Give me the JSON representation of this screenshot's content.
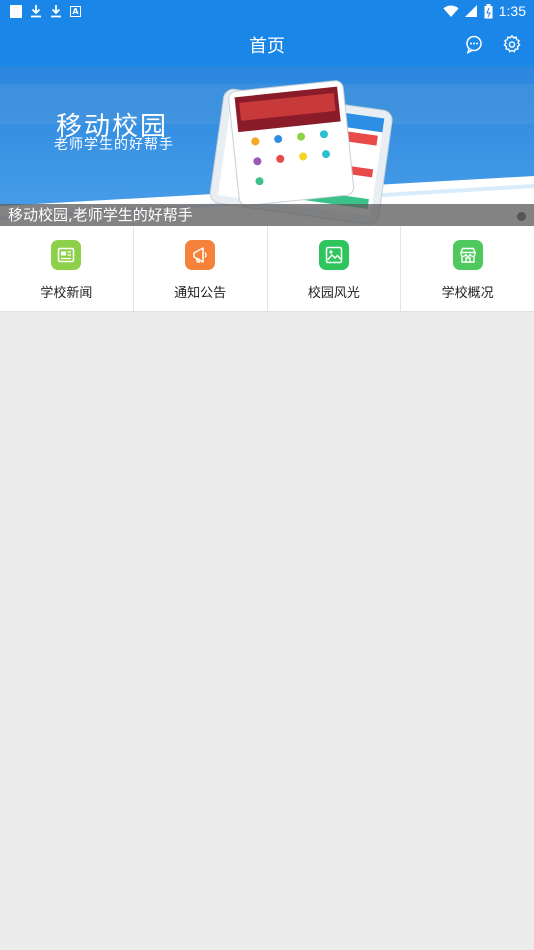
{
  "status_bar": {
    "time": "1:35"
  },
  "app_bar": {
    "title": "首页",
    "icons": [
      "chat-icon",
      "gear-icon"
    ]
  },
  "banner": {
    "heading": "移动校园",
    "subheading": "老师学生的好帮手",
    "caption": "移动校园,老师学生的好帮手"
  },
  "menu": {
    "items": [
      {
        "label": "学校新闻",
        "icon": "news-icon",
        "color": "#8dd04a"
      },
      {
        "label": "通知公告",
        "icon": "announcement-icon",
        "color": "#f5813a"
      },
      {
        "label": "校园风光",
        "icon": "image-icon",
        "color": "#2dc55c"
      },
      {
        "label": "学校概况",
        "icon": "store-icon",
        "color": "#4fc85d"
      }
    ]
  },
  "colors": {
    "primary": "#1a87e8",
    "background": "#ececec"
  }
}
